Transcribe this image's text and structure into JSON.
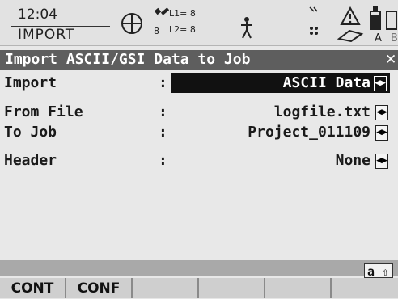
{
  "status": {
    "time": "12:04",
    "mode": "IMPORT",
    "sat_count_left": "8",
    "l1": "L1= 8",
    "l2": "L2= 8",
    "battery_label": "A",
    "battery_label2": "B",
    "icons": [
      "crosshair-icon",
      "satellite-icon",
      "person-walking-icon",
      "signal-icon",
      "radio-icon",
      "warning-icon",
      "card-icon",
      "battery-icon"
    ]
  },
  "title": {
    "text": "Import ASCII/GSI Data to Job",
    "close": "✕"
  },
  "fields": [
    {
      "label": "Import",
      "colon": ":",
      "value": "ASCII Data",
      "selected": true
    },
    {
      "label": "From File",
      "colon": ":",
      "value": "logfile.txt",
      "selected": false
    },
    {
      "label": "To Job",
      "colon": ":",
      "value": "Project_011109",
      "selected": false
    },
    {
      "label": "Header",
      "colon": ":",
      "value": "None",
      "selected": false
    }
  ],
  "input_mode": "a",
  "input_mode_arrow": "⇧",
  "softkeys": [
    "CONT",
    "CONF",
    "",
    "",
    "",
    ""
  ],
  "colors": {
    "title_bg": "#5e5e5e",
    "selected_bg": "#111111",
    "softkey_bg": "#cfcfcf"
  }
}
